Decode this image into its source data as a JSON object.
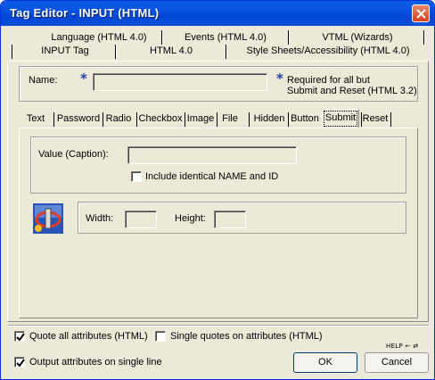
{
  "window": {
    "title": "Tag Editor - INPUT   (HTML)"
  },
  "top_tabs": {
    "row1": [
      "Language (HTML 4.0)",
      "Events (HTML 4.0)",
      "VTML (Wizards)"
    ],
    "row2": [
      "INPUT Tag",
      "HTML 4.0",
      "Style Sheets/Accessibility (HTML 4.0)"
    ],
    "active": "INPUT Tag"
  },
  "name_group": {
    "label": "Name:",
    "value": "",
    "required_note_line1": "Required for all but",
    "required_note_line2": "Submit and Reset (HTML 3.2)"
  },
  "sub_tabs": {
    "items": [
      "Text",
      "Password",
      "Radio",
      "Checkbox",
      "Image",
      "File",
      "Hidden",
      "Button",
      "Submit",
      "Reset"
    ],
    "active": "Submit"
  },
  "submit_panel": {
    "value_label": "Value (Caption):",
    "value": "",
    "include_identical_label": "Include identical NAME and ID",
    "include_identical_checked": false,
    "width_label": "Width:",
    "width_value": "",
    "height_label": "Height:",
    "height_value": ""
  },
  "options": {
    "quote_all_label": "Quote all attributes (HTML)",
    "quote_all_checked": true,
    "single_quotes_label": "Single quotes on attributes (HTML)",
    "single_quotes_checked": false,
    "output_single_line_label": "Output attributes on single line",
    "output_single_line_checked": true
  },
  "help_links": "HELP ← ⇄",
  "buttons": {
    "ok": "OK",
    "cancel": "Cancel"
  },
  "colors": {
    "title_bar": "#0553e1",
    "dialog_bg": "#ece9d8",
    "close_button": "#d5411a",
    "required_star": "#1f3fa8"
  }
}
